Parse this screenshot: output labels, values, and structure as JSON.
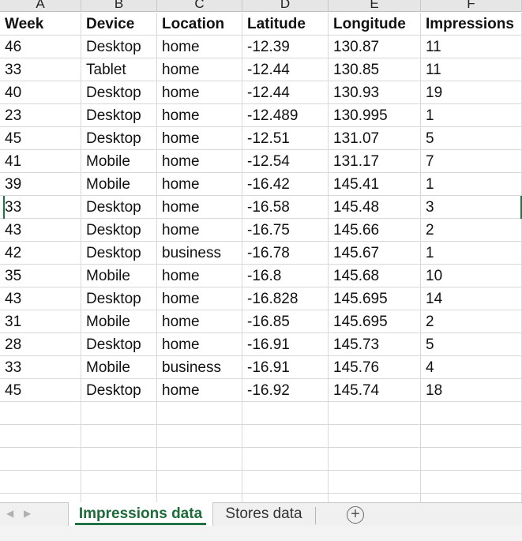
{
  "columns": [
    "A",
    "B",
    "C",
    "D",
    "E",
    "F"
  ],
  "table": {
    "headers": [
      "Week",
      "Device",
      "Location",
      "Latitude",
      "Longitude",
      "Impressions"
    ],
    "rows": [
      [
        "46",
        "Desktop",
        "home",
        "-12.39",
        "130.87",
        "11"
      ],
      [
        "33",
        "Tablet",
        "home",
        "-12.44",
        "130.85",
        "11"
      ],
      [
        "40",
        "Desktop",
        "home",
        "-12.44",
        "130.93",
        "19"
      ],
      [
        "23",
        "Desktop",
        "home",
        "-12.489",
        "130.995",
        "1"
      ],
      [
        "45",
        "Desktop",
        "home",
        "-12.51",
        "131.07",
        "5"
      ],
      [
        "41",
        "Mobile",
        "home",
        "-12.54",
        "131.17",
        "7"
      ],
      [
        "39",
        "Mobile",
        "home",
        "-16.42",
        "145.41",
        "1"
      ],
      [
        "33",
        "Desktop",
        "home",
        "-16.58",
        "145.48",
        "3"
      ],
      [
        "43",
        "Desktop",
        "home",
        "-16.75",
        "145.66",
        "2"
      ],
      [
        "42",
        "Desktop",
        "business",
        "-16.78",
        "145.67",
        "1"
      ],
      [
        "35",
        "Mobile",
        "home",
        "-16.8",
        "145.68",
        "10"
      ],
      [
        "43",
        "Desktop",
        "home",
        "-16.828",
        "145.695",
        "14"
      ],
      [
        "31",
        "Mobile",
        "home",
        "-16.85",
        "145.695",
        "2"
      ],
      [
        "28",
        "Desktop",
        "home",
        "-16.91",
        "145.73",
        "5"
      ],
      [
        "33",
        "Mobile",
        "business",
        "-16.91",
        "145.76",
        "4"
      ],
      [
        "45",
        "Desktop",
        "home",
        "-16.92",
        "145.74",
        "18"
      ]
    ]
  },
  "tabs": {
    "active": "Impressions data",
    "second": "Stores data",
    "add_symbol": "+"
  },
  "colors": {
    "accent": "#217346",
    "active_tab_text": "#1d6b3a"
  }
}
